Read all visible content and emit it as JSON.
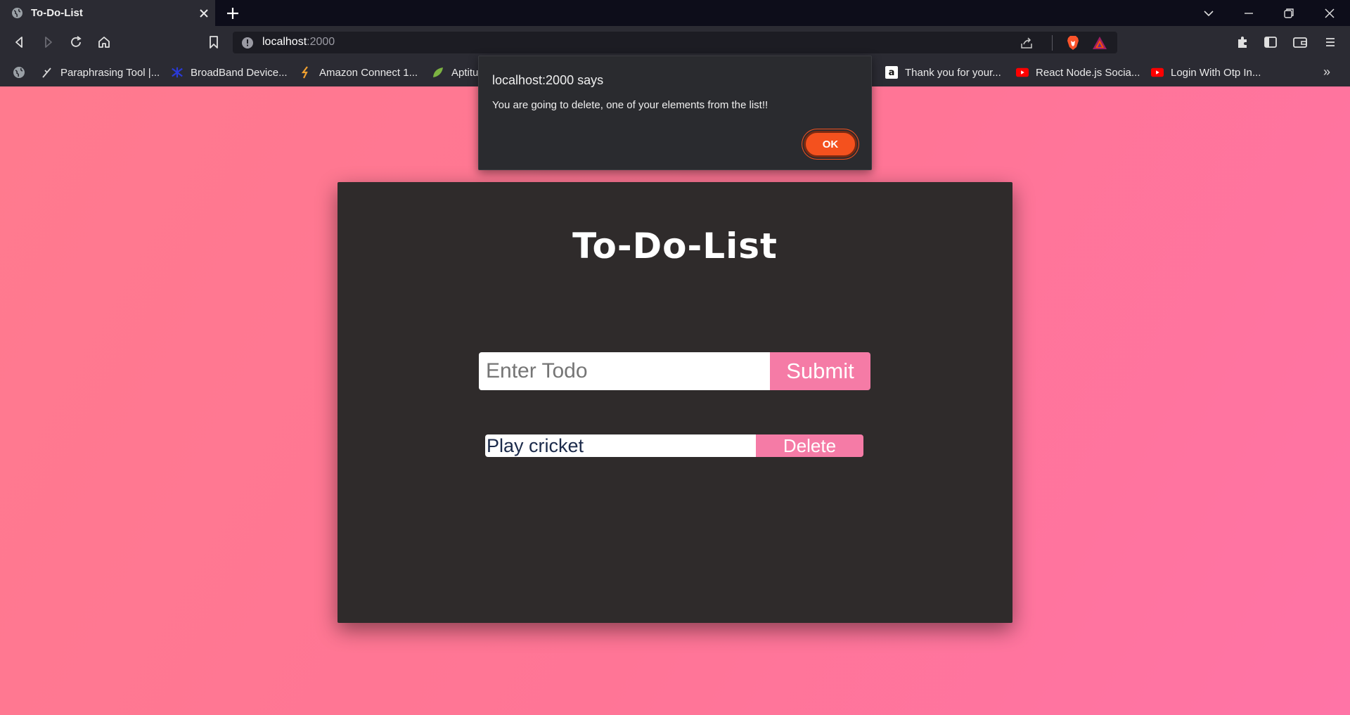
{
  "browser": {
    "tab": {
      "title": "To-Do-List"
    },
    "url": {
      "host": "localhost",
      "port": ":2000"
    },
    "bookmarks": [
      {
        "label": "Paraphrasing Tool |...",
        "icon": "feather-icon"
      },
      {
        "label": "BroadBand Device...",
        "icon": "network-icon"
      },
      {
        "label": "Amazon Connect 1...",
        "icon": "bolt-icon"
      },
      {
        "label": "Aptitu",
        "icon": "leaf-icon"
      },
      {
        "label": "Thank you for your...",
        "icon": "amazon-icon"
      },
      {
        "label": "React Node.js Socia...",
        "icon": "youtube-icon"
      },
      {
        "label": "Login With Otp In...",
        "icon": "youtube-icon"
      }
    ],
    "more": "»"
  },
  "app": {
    "title": "To-Do-List",
    "input": {
      "placeholder": "Enter Todo",
      "value": ""
    },
    "submit_label": "Submit",
    "items": [
      {
        "text": "Play cricket",
        "delete_label": "Delete"
      }
    ]
  },
  "dialog": {
    "title": "localhost:2000 says",
    "message": "You are going to delete, one of your elements from the list!!",
    "ok_label": "OK"
  },
  "colors": {
    "page_bg": "#ff7b8f",
    "card_bg": "#2f2b2b",
    "accent_pink": "#f57ba6",
    "ok_orange": "#f4511e"
  }
}
